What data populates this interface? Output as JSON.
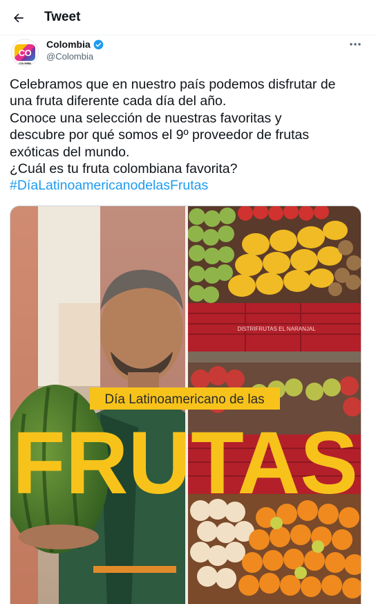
{
  "topbar": {
    "title": "Tweet"
  },
  "author": {
    "display_name": "Colombia",
    "handle": "@Colombia",
    "avatar_text": "CO",
    "avatar_subtext": "COLOMBIA",
    "verified": true
  },
  "tweet": {
    "lines": [
      "Celebramos que en nuestro país podemos disfrutar de",
      "una fruta diferente cada día del año.",
      "Conoce una selección de nuestras favoritas y",
      "descubre por qué somos el 9º proveedor de frutas",
      "exóticas del mundo.",
      "¿Cuál es tu fruta colombiana favorita?"
    ],
    "hashtag": "#DíaLatinoamericanodelasFrutas"
  },
  "media": {
    "banner_text": "Día Latinoamericano de las",
    "big_text": "FRUTAS",
    "crate_label": "DISTRIFRUTAS EL NARANJAL"
  },
  "colors": {
    "accent": "#1d9bf0",
    "banner_yellow": "#f7c31b",
    "crate_red": "#b3202a"
  }
}
